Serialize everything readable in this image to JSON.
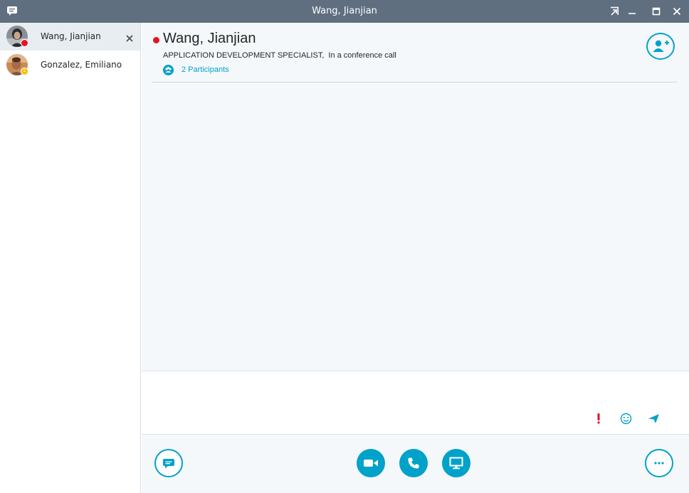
{
  "window": {
    "title": "Wang, Jianjian"
  },
  "colors": {
    "accent": "#00a2c9",
    "titlebar": "#5f6f80",
    "presence_busy": "#e81123",
    "presence_away": "#f8c000"
  },
  "sidebar": {
    "conversations": [
      {
        "name": "Wang, Jianjian",
        "presence": "busy",
        "active": true,
        "avatar": "avatar-photo-icon"
      },
      {
        "name": "Gonzalez, Emiliano",
        "presence": "away",
        "active": false,
        "avatar": "avatar-photo-icon"
      }
    ]
  },
  "header": {
    "contact_name": "Wang, Jianjian",
    "job_title": "APPLICATION DEVELOPMENT SPECIALIST,",
    "status": "In a conference call",
    "participants_label": "2 Participants"
  },
  "compose": {
    "icons": [
      "importance-icon",
      "emoticon-icon",
      "send-icon"
    ]
  },
  "toolbar": {
    "icons": [
      "im-icon",
      "video-icon",
      "call-icon",
      "present-icon",
      "more-options-icon"
    ]
  }
}
